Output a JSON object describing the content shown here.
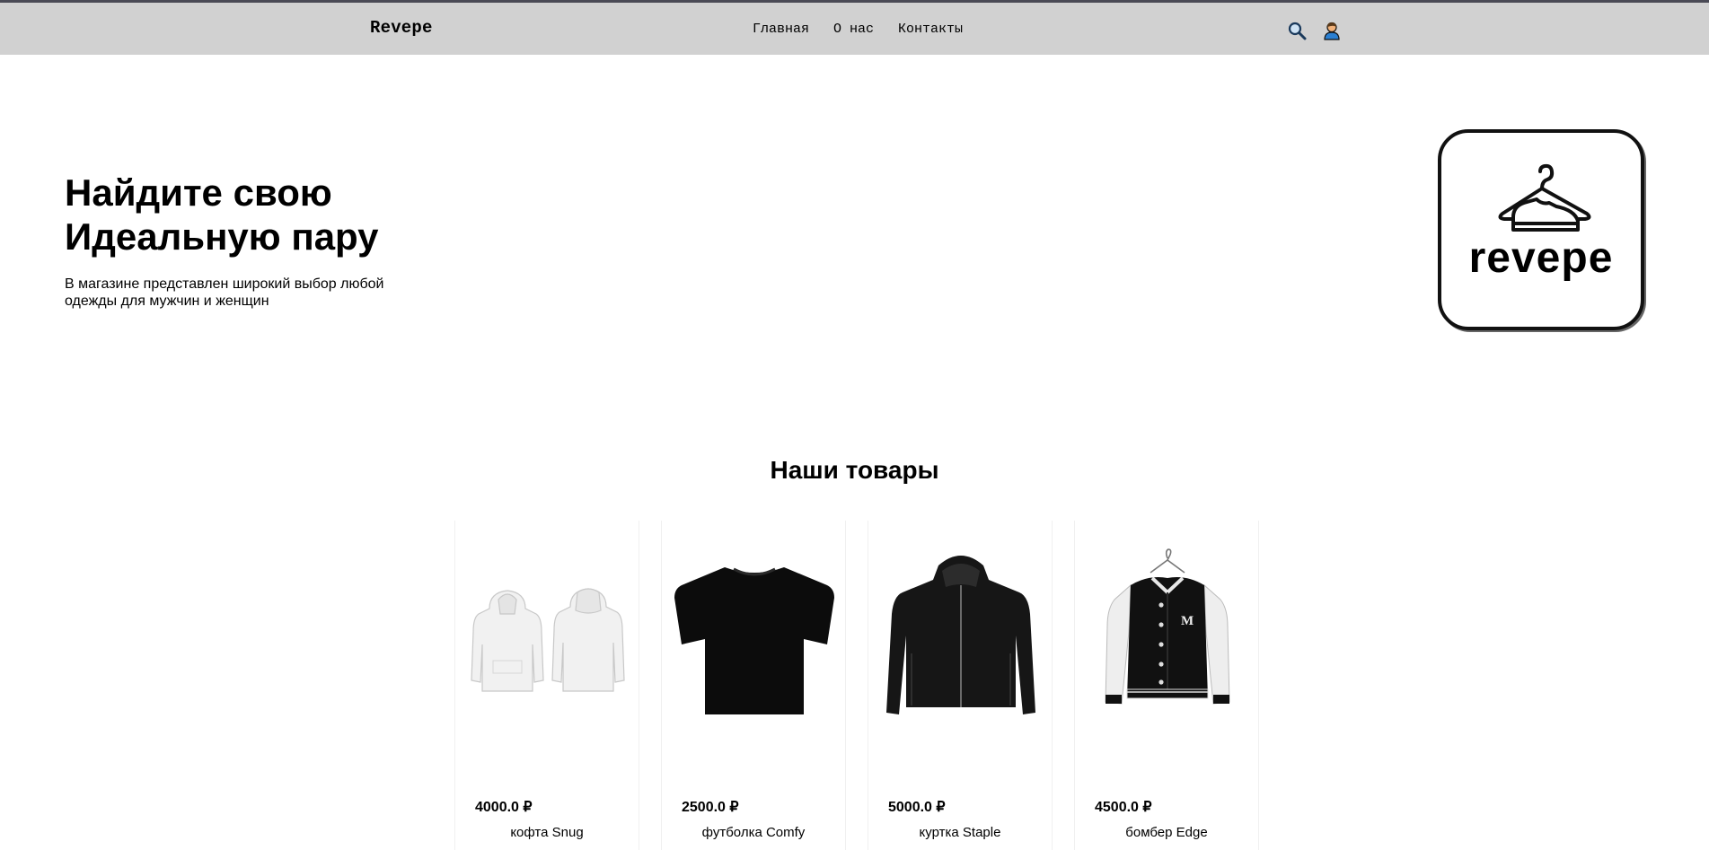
{
  "header": {
    "brand": "Revepe",
    "nav": [
      "Главная",
      "О нас",
      "Контакты"
    ],
    "icons": [
      "search-icon",
      "user-icon"
    ]
  },
  "hero": {
    "title_line1": "Найдите свою",
    "title_line2": "Идеальную пару",
    "subtitle": "В магазине представлен широкий выбор любой одежды для мужчин и женщин",
    "logo_text": "revepe"
  },
  "products_section": {
    "title": "Наши товары",
    "items": [
      {
        "price": "4000.0 ₽",
        "name": "кофта Snug",
        "image": "white-hoodies"
      },
      {
        "price": "2500.0 ₽",
        "name": "футболка Comfy",
        "image": "black-tshirt"
      },
      {
        "price": "5000.0 ₽",
        "name": "куртка Staple",
        "image": "black-jacket"
      },
      {
        "price": "4500.0 ₽",
        "name": "бомбер Edge",
        "image": "varsity-bomber"
      }
    ]
  },
  "colors": {
    "header_bg": "#d1d1d1",
    "top_line": "#4a4a55",
    "accent_user": "#2a7fd1"
  }
}
